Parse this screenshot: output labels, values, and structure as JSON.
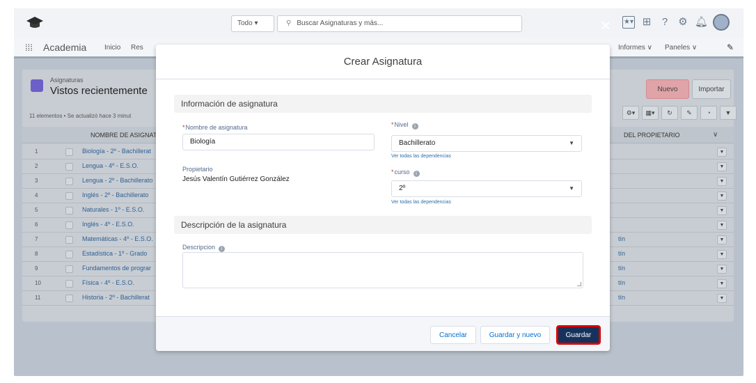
{
  "topbar": {
    "scope_label": "Todo",
    "search_placeholder": "Buscar Asignaturas y más..."
  },
  "navbar": {
    "app_name": "Academia",
    "items": [
      "Inicio",
      "Res"
    ],
    "right_items": [
      "Informes",
      "Paneles"
    ]
  },
  "list": {
    "object_label": "Asignaturas",
    "view_title": "Vistos recientemente",
    "meta": "11 elementos • Se actualizó hace 3 minut",
    "new_button": "Nuevo",
    "import_button": "Importar",
    "col_name": "NOMBRE DE ASIGNATU",
    "col_owner": "DEL PROPIETARIO",
    "rows": [
      {
        "num": "1",
        "name": "Biología - 2º - Bachillerat",
        "owner": ""
      },
      {
        "num": "2",
        "name": "Lengua - 4º - E.S.O.",
        "owner": ""
      },
      {
        "num": "3",
        "name": "Lengua - 2º - Bachillerato",
        "owner": ""
      },
      {
        "num": "4",
        "name": "Inglés - 2º - Bachillerato",
        "owner": ""
      },
      {
        "num": "5",
        "name": "Naturales - 1º - E.S.O.",
        "owner": ""
      },
      {
        "num": "6",
        "name": "Inglés - 4º - E.S.O.",
        "owner": ""
      },
      {
        "num": "7",
        "name": "Matemáticas - 4º - E.S.O.",
        "owner": "tín"
      },
      {
        "num": "8",
        "name": "Estadística - 1º - Grado",
        "owner": "tín"
      },
      {
        "num": "9",
        "name": "Fundamentos de prograr",
        "owner": "tín"
      },
      {
        "num": "10",
        "name": "Física - 4º - E.S.O.",
        "owner": "tín"
      },
      {
        "num": "11",
        "name": "Historia - 2º - Bachillerat",
        "owner": "tín"
      }
    ]
  },
  "modal": {
    "title": "Crear Asignatura",
    "section_info": "Información de asignatura",
    "name_label": "Nombre de asignatura",
    "name_value": "Biología",
    "nivel_label": "Nivel",
    "nivel_value": "Bachillerato",
    "curso_label": "curso",
    "curso_value": "2º",
    "dependencies_link": "Ver todas las dependencias",
    "owner_label": "Propietario",
    "owner_value": "Jesús Valentín Gutiérrez González",
    "section_desc": "Descripción de la asignatura",
    "desc_label": "Descripcion",
    "cancel_button": "Cancelar",
    "save_new_button": "Guardar y nuevo",
    "save_button": "Guardar"
  },
  "colors": {
    "primary_button": "#16325c",
    "highlight_border": "#d40000",
    "link": "#0070d2",
    "required": "#c23934"
  }
}
